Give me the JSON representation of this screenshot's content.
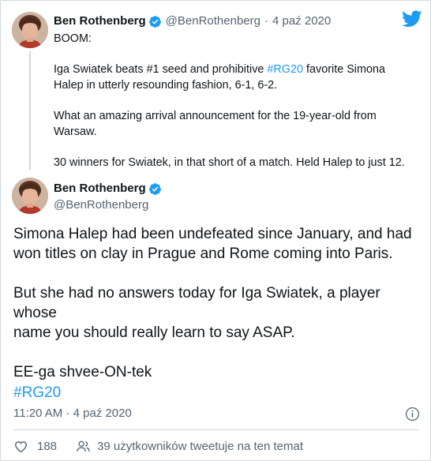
{
  "parent_tweet": {
    "name": "Ben Rothenberg",
    "handle": "@BenRothenberg",
    "separator": "·",
    "date": "4 paź 2020",
    "lines": [
      "BOOM:",
      "Iga Swiatek beats #1 seed and prohibitive",
      "#RG20",
      "favorite Simona",
      "Halep in utterly resounding fashion, 6-1, 6-2.",
      "What an amazing arrival announcement for the 19-year-old from",
      "Warsaw.",
      "30 winners for Swiatek, in that short of a match. Held Halep to just 12."
    ]
  },
  "main_tweet": {
    "name": "Ben Rothenberg",
    "handle": "@BenRothenberg",
    "paragraph1": [
      "Simona Halep had been undefeated since January, and had",
      "won titles on clay in Prague and Rome coming into Paris."
    ],
    "paragraph2": [
      "But she had no answers today for Iga Swiatek, a player whose",
      "name you should really learn to say ASAP."
    ],
    "paragraph3": "EE-ga shvee-ON-tek",
    "hashtag": "#RG20",
    "timestamp": "11:20 AM · 4 paź 2020"
  },
  "actions": {
    "like_count": "188",
    "people_text": "39 użytkowników tweetuje na ten temat"
  },
  "icons": {
    "logo": "twitter-bird-icon",
    "verified": "verified-badge-icon",
    "info": "info-icon",
    "like": "heart-icon",
    "people": "people-icon"
  },
  "colors": {
    "accent": "#1d9bf0",
    "text": "#0f1419",
    "muted": "#536471",
    "border": "#cfd9de"
  }
}
